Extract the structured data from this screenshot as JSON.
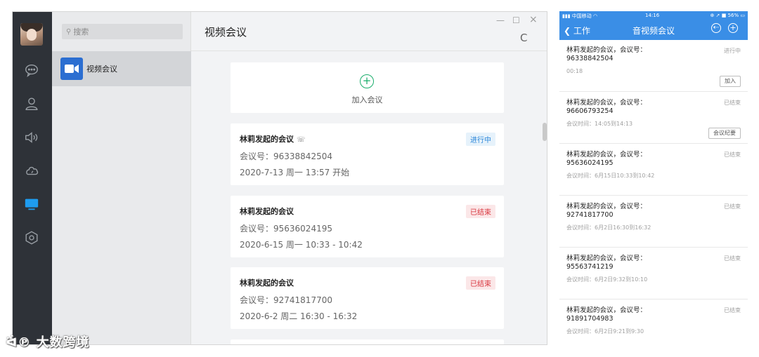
{
  "desktop": {
    "search_placeholder": "搜索",
    "conversation": "视频会议",
    "title": "视频会议",
    "window_controls": {
      "minimize": "—",
      "maximize": "☐",
      "close": "×"
    },
    "refresh_glyph": "C",
    "join": {
      "plus": "+",
      "label": "加入会议"
    },
    "meetings": [
      {
        "title": "林莉发起的会议",
        "phone": "☏",
        "number": "会议号：96338842504",
        "time": "2020-7-13 周一 13:57 开始",
        "status": "进行中"
      },
      {
        "title": "林莉发起的会议",
        "number": "会议号：95636024195",
        "time": "2020-6-15 周一 10:33 - 10:42",
        "status": "已结束"
      },
      {
        "title": "林莉发起的会议",
        "number": "会议号：92741817700",
        "time": "2020-6-2 周二 16:30 - 16:32",
        "status": "已结束"
      }
    ]
  },
  "watermark": "大数跨境",
  "phone": {
    "status_left": "中国移动",
    "status_time": "14:16",
    "status_right": "56%",
    "back": "工作",
    "title": "音视频会议",
    "items": [
      {
        "a": "林莉发起的会议，会议号：",
        "b": "96338842504",
        "sub": "00:18",
        "status": "进行中",
        "btn": "加入"
      },
      {
        "a": "林莉发起的会议，会议号：",
        "b": "96606793254",
        "sub": "会议时间：14:05到14:13",
        "status": "已结束",
        "btn": "会议纪要"
      },
      {
        "a": "林莉发起的会议，会议号：",
        "b": "95636024195",
        "sub": "会议时间：6月15日10:33到10:42",
        "status": "已结束"
      },
      {
        "a": "林莉发起的会议，会议号：",
        "b": "92741817700",
        "sub": "会议时间：6月2日16:30到16:32",
        "status": "已结束"
      },
      {
        "a": "林莉发起的会议，会议号：",
        "b": "95563741219",
        "sub": "会议时间：6月2日9:32到10:10",
        "status": "已结束"
      },
      {
        "a": "林莉发起的会议，会议号：",
        "b": "91891704983",
        "sub": "会议时间：6月2日9:21到9:30",
        "status": "已结束"
      }
    ]
  }
}
